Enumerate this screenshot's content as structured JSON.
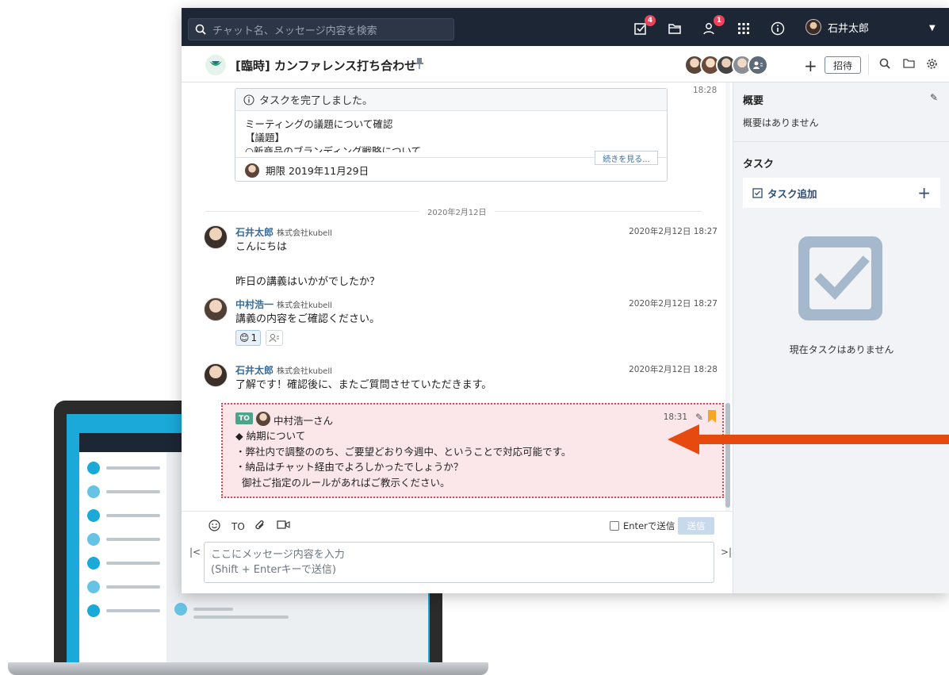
{
  "search": {
    "placeholder": "チャット名、メッセージ内容を検索"
  },
  "topbar": {
    "task_badge": "4",
    "contact_badge": "1",
    "user_name": "石井太郎"
  },
  "room": {
    "title": "[臨時] カンファレンス打ち合わせ",
    "invite_label": "招待"
  },
  "task_message": {
    "time": "18:28",
    "header": "タスクを完了しました。",
    "body": "ミーティングの議題について確認\n【議題】\n○新商品のブランディング戦略について",
    "more_label": "続きを見る...",
    "deadline": "期限 2019年11月29日"
  },
  "date_separator": "2020年2月12日",
  "messages": [
    {
      "name": "石井太郎",
      "org": "株式会社kubell",
      "time": "2020年2月12日 18:27",
      "text": "こんにちは\n\n昨日の講義はいかがでしたか？"
    },
    {
      "name": "中村浩一",
      "org": "株式会社kubell",
      "time": "2020年2月12日 18:27",
      "text": "講義の内容をご確認ください。"
    },
    {
      "name": "石井太郎",
      "org": "株式会社kubell",
      "time": "2020年2月12日 18:28",
      "text": "了解です！確認後に、またご質問させていただきます。"
    }
  ],
  "reaction": {
    "count": "1"
  },
  "to_message": {
    "badge": "TO",
    "recipient": "中村浩一さん",
    "time": "18:31",
    "text": "◆ 納期について\n・弊社内で調整ののち、ご要望どおり今週中、ということで対応可能です。\n・納品はチャット経由でよろしかったでしょうか？\n  御社ご指定のルールがあればご教示ください。"
  },
  "composer": {
    "to_label": "TO",
    "enter_send_label": "Enterで送信",
    "send_label": "送信",
    "input_placeholder_line1": "ここにメッセージ内容を入力",
    "input_placeholder_line2": "(Shift + Enterキーで送信)"
  },
  "right_panel": {
    "overview_title": "概要",
    "overview_text": "概要はありません",
    "task_title": "タスク",
    "add_task_label": "タスク追加",
    "empty_text": "現在タスクはありません"
  },
  "colors": {
    "topbar_bg": "#1d2634",
    "accent_blue": "#1aa9d8",
    "to_highlight_bg": "#fbe7ea",
    "arrow_orange": "#e64a0f",
    "badge_red": "#e8455a"
  }
}
